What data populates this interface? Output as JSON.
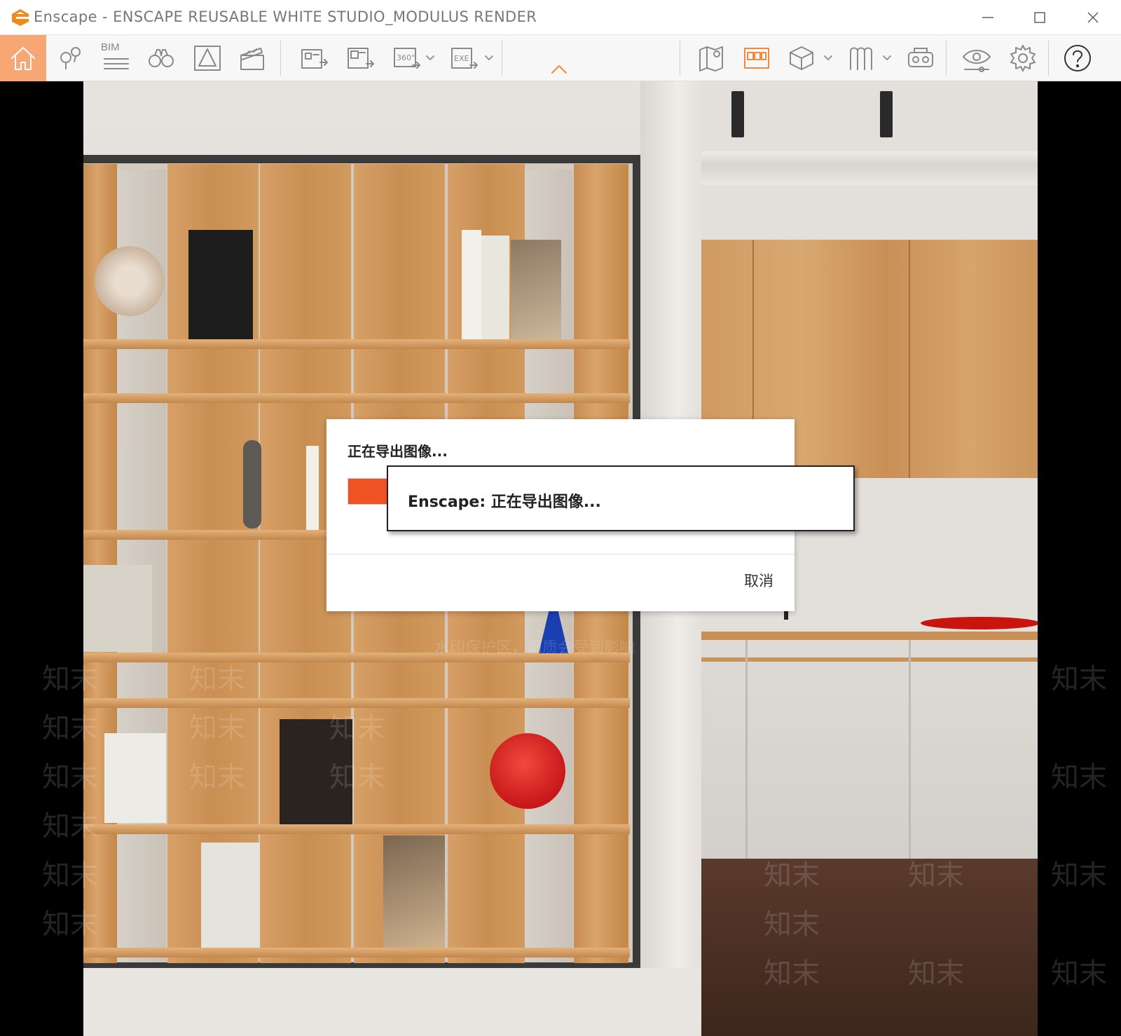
{
  "window": {
    "app_name": "Enscape",
    "title": "Enscape - ENSCAPE REUSABLE WHITE STUDIO_MODULUS RENDER",
    "controls": [
      "minimize",
      "maximize",
      "close"
    ]
  },
  "toolbar": {
    "bim_label": "BIM",
    "left_buttons": [
      {
        "name": "home",
        "icon": "home-icon",
        "active": true
      },
      {
        "name": "views",
        "icon": "location-pins-icon"
      },
      {
        "name": "bim",
        "icon": "bim-icon"
      },
      {
        "name": "walk",
        "icon": "binoculars-icon"
      },
      {
        "name": "perspective",
        "icon": "perspective-cone-icon"
      },
      {
        "name": "video",
        "icon": "clapperboard-icon"
      },
      {
        "name": "batch-render",
        "icon": "batch-render-icon"
      },
      {
        "name": "export-image",
        "icon": "export-image-icon"
      },
      {
        "name": "panorama",
        "icon": "360-panorama-icon",
        "dropdown": true
      },
      {
        "name": "exe-export",
        "icon": "exe-export-icon",
        "dropdown": true
      }
    ],
    "right_buttons": [
      {
        "name": "map",
        "icon": "map-pin-icon"
      },
      {
        "name": "asset-library",
        "icon": "asset-library-icon",
        "highlight": true
      },
      {
        "name": "view-mode",
        "icon": "cube-icon",
        "dropdown": true
      },
      {
        "name": "materials",
        "icon": "materials-icon",
        "dropdown": true
      },
      {
        "name": "vr",
        "icon": "vr-headset-icon"
      },
      {
        "name": "visual-settings",
        "icon": "eye-settings-icon"
      },
      {
        "name": "settings",
        "icon": "gear-icon"
      },
      {
        "name": "help",
        "icon": "help-icon"
      }
    ],
    "collapse_icon": "chevron-up-icon",
    "accent_color": "#f7a774"
  },
  "dialog": {
    "heading": "正在导出图像...",
    "progress": 0.105,
    "progress_color": "#f05323",
    "cancel_label": "取消"
  },
  "tooltip": {
    "text": "Enscape: 正在导出图像..."
  },
  "watermark": {
    "text": "知末",
    "notice": "水印保护区，画质会受到影响"
  }
}
